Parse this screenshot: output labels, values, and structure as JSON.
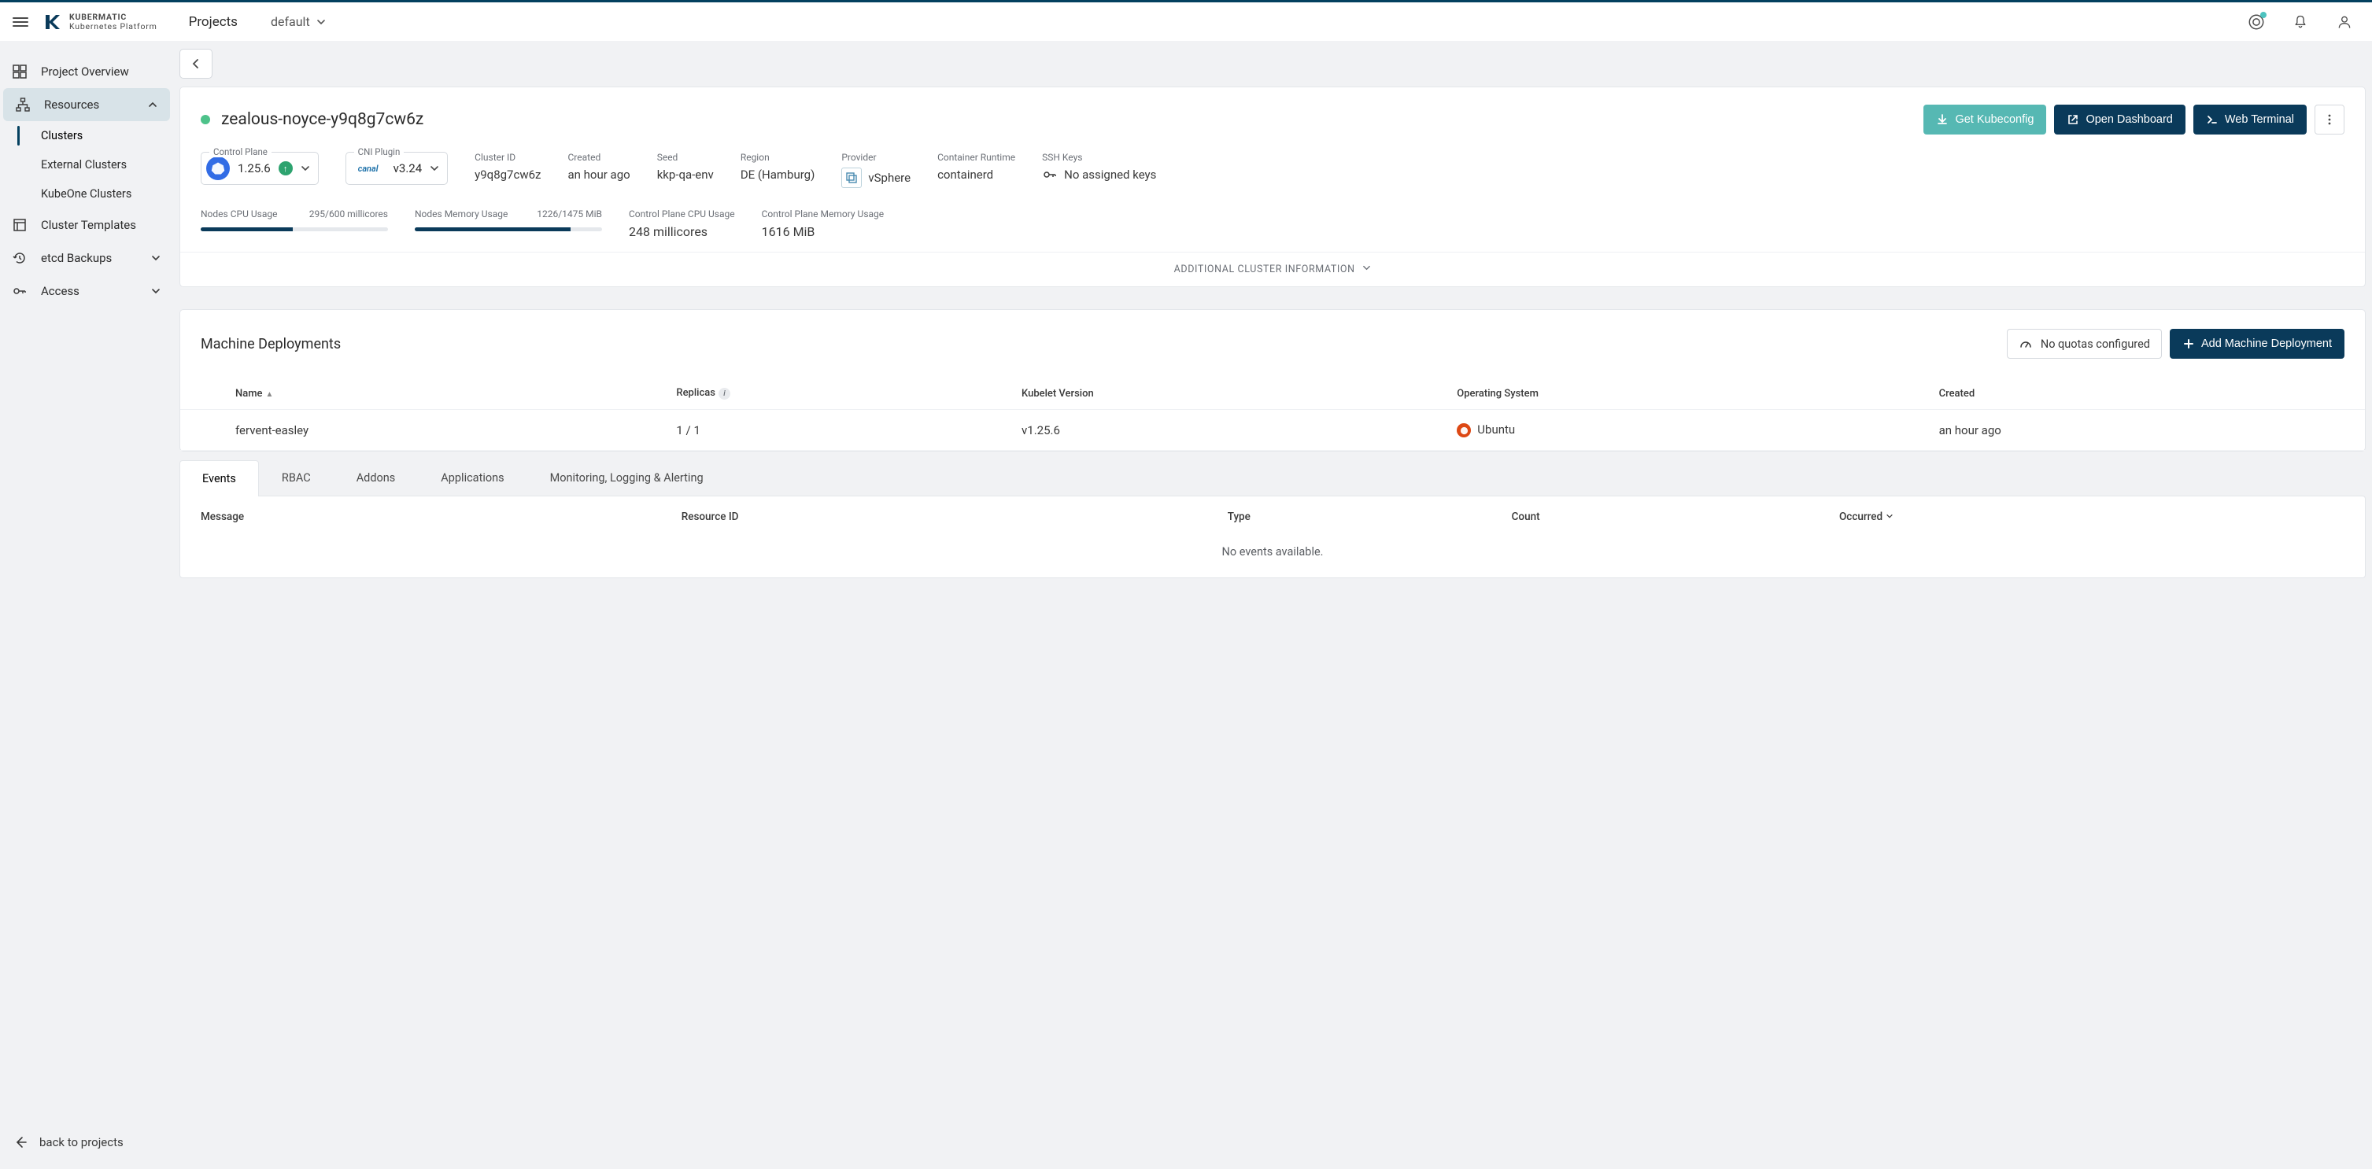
{
  "topbar": {
    "brand_line1": "KUBERMATIC",
    "brand_line2": "Kubernetes Platform",
    "crumb": "Projects",
    "project": "default"
  },
  "sidebar": {
    "overview": "Project Overview",
    "resources": "Resources",
    "clusters": "Clusters",
    "external_clusters": "External Clusters",
    "kubeone_clusters": "KubeOne Clusters",
    "templates": "Cluster Templates",
    "etcd": "etcd Backups",
    "access": "Access",
    "back": "back to projects"
  },
  "cluster": {
    "name": "zealous-noyce-y9q8g7cw6z",
    "actions": {
      "kubeconfig": "Get Kubeconfig",
      "dashboard": "Open Dashboard",
      "terminal": "Web Terminal"
    },
    "control_plane_label": "Control Plane",
    "control_plane_version": "1.25.6",
    "cni_label": "CNI Plugin",
    "cni_name": "canal",
    "cni_version": "v3.24",
    "cluster_id_label": "Cluster ID",
    "cluster_id": "y9q8g7cw6z",
    "created_label": "Created",
    "created": "an hour ago",
    "seed_label": "Seed",
    "seed": "kkp-qa-env",
    "region_label": "Region",
    "region": "DE (Hamburg)",
    "provider_label": "Provider",
    "provider": "vSphere",
    "runtime_label": "Container Runtime",
    "runtime": "containerd",
    "ssh_label": "SSH Keys",
    "ssh": "No assigned keys",
    "nodes_cpu_label": "Nodes CPU Usage",
    "nodes_cpu_value": "295/600 millicores",
    "nodes_cpu_pct": 49,
    "nodes_mem_label": "Nodes Memory Usage",
    "nodes_mem_value": "1226/1475 MiB",
    "nodes_mem_pct": 83,
    "cp_cpu_label": "Control Plane CPU Usage",
    "cp_cpu_value": "248 millicores",
    "cp_mem_label": "Control Plane Memory Usage",
    "cp_mem_value": "1616 MiB",
    "expander": "ADDITIONAL CLUSTER INFORMATION"
  },
  "md": {
    "title": "Machine Deployments",
    "quota": "No quotas configured",
    "add": "Add Machine Deployment",
    "cols": {
      "name": "Name",
      "replicas": "Replicas",
      "kubelet": "Kubelet Version",
      "os": "Operating System",
      "created": "Created"
    },
    "row": {
      "name": "fervent-easley",
      "replicas": "1 / 1",
      "kubelet": "v1.25.6",
      "os": "Ubuntu",
      "created": "an hour ago"
    }
  },
  "tabs": {
    "events": "Events",
    "rbac": "RBAC",
    "addons": "Addons",
    "apps": "Applications",
    "mla": "Monitoring, Logging & Alerting",
    "ev_cols": {
      "message": "Message",
      "resource": "Resource ID",
      "type": "Type",
      "count": "Count",
      "occurred": "Occurred"
    },
    "empty": "No events available."
  }
}
